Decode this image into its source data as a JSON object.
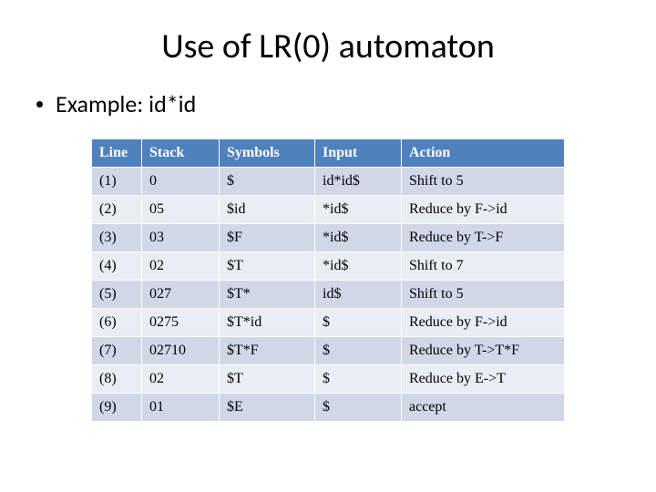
{
  "title": "Use of LR(0) automaton",
  "bullet": "Example: id*id",
  "table": {
    "headers": [
      "Line",
      "Stack",
      "Symbols",
      "Input",
      "Action"
    ],
    "rows": [
      [
        "(1)",
        "0",
        "$",
        "id*id$",
        "Shift to 5"
      ],
      [
        "(2)",
        "05",
        "$id",
        "*id$",
        "Reduce by F->id"
      ],
      [
        "(3)",
        "03",
        "$F",
        "*id$",
        "Reduce by T->F"
      ],
      [
        "(4)",
        "02",
        "$T",
        "*id$",
        "Shift to 7"
      ],
      [
        "(5)",
        "027",
        "$T*",
        "id$",
        "Shift to 5"
      ],
      [
        "(6)",
        "0275",
        "$T*id",
        "$",
        "Reduce by F->id"
      ],
      [
        "(7)",
        "02710",
        "$T*F",
        "$",
        "Reduce by T->T*F"
      ],
      [
        "(8)",
        "02",
        "$T",
        "$",
        "Reduce by E->T"
      ],
      [
        "(9)",
        "01",
        "$E",
        "$",
        "accept"
      ]
    ]
  },
  "chart_data": {
    "type": "table",
    "title": "Use of LR(0) automaton — Example: id*id",
    "columns": [
      "Line",
      "Stack",
      "Symbols",
      "Input",
      "Action"
    ],
    "rows": [
      {
        "Line": "(1)",
        "Stack": "0",
        "Symbols": "$",
        "Input": "id*id$",
        "Action": "Shift to 5"
      },
      {
        "Line": "(2)",
        "Stack": "05",
        "Symbols": "$id",
        "Input": "*id$",
        "Action": "Reduce by F->id"
      },
      {
        "Line": "(3)",
        "Stack": "03",
        "Symbols": "$F",
        "Input": "*id$",
        "Action": "Reduce by T->F"
      },
      {
        "Line": "(4)",
        "Stack": "02",
        "Symbols": "$T",
        "Input": "*id$",
        "Action": "Shift to 7"
      },
      {
        "Line": "(5)",
        "Stack": "027",
        "Symbols": "$T*",
        "Input": "id$",
        "Action": "Shift to 5"
      },
      {
        "Line": "(6)",
        "Stack": "0275",
        "Symbols": "$T*id",
        "Input": "$",
        "Action": "Reduce by F->id"
      },
      {
        "Line": "(7)",
        "Stack": "02710",
        "Symbols": "$T*F",
        "Input": "$",
        "Action": "Reduce by T->T*F"
      },
      {
        "Line": "(8)",
        "Stack": "02",
        "Symbols": "$T",
        "Input": "$",
        "Action": "Reduce by E->T"
      },
      {
        "Line": "(9)",
        "Stack": "01",
        "Symbols": "$E",
        "Input": "$",
        "Action": "accept"
      }
    ]
  }
}
